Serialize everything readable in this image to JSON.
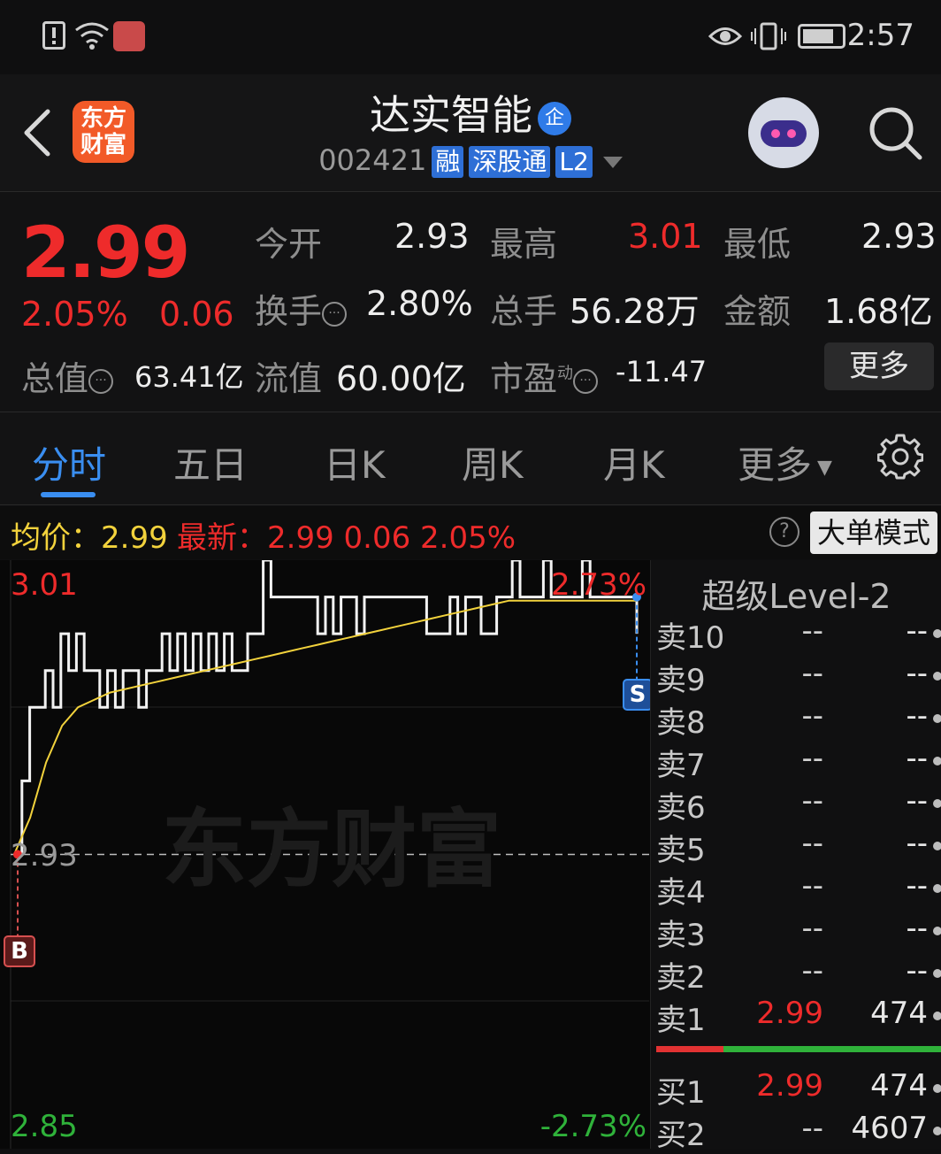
{
  "status_bar": {
    "time": "2:57"
  },
  "header": {
    "title": "达实智能",
    "title_badge": "企",
    "code": "002421",
    "tags": [
      "融",
      "深股通",
      "L2"
    ],
    "logo_line1": "东方",
    "logo_line2": "财富"
  },
  "quote": {
    "price": "2.99",
    "change_pct": "2.05%",
    "change": "0.06",
    "open_label": "今开",
    "open": "2.93",
    "high_label": "最高",
    "high": "3.01",
    "low_label": "最低",
    "low": "2.93",
    "turnover_label": "换手",
    "turnover": "2.80%",
    "volume_label": "总手",
    "volume": "56.28万",
    "amount_label": "金额",
    "amount": "1.68亿",
    "mktcap_label": "总值",
    "mktcap": "63.41亿",
    "float_label": "流值",
    "float": "60.00亿",
    "pe_label": "市盈",
    "pe_sup": "动",
    "pe": "-11.47",
    "more_label": "更多"
  },
  "tabs": [
    {
      "label": "分时"
    },
    {
      "label": "五日"
    },
    {
      "label": "日K"
    },
    {
      "label": "周K"
    },
    {
      "label": "月K"
    },
    {
      "label": "更多"
    }
  ],
  "info": {
    "avg_text": "均价：2.99",
    "latest_text": "最新：2.99  0.06  2.05%",
    "help_icon": "?",
    "big_order_mode": "大单模式"
  },
  "chart_data": {
    "type": "line",
    "y_max_label": "3.01",
    "y_mid_label": "2.93",
    "y_min_label": "2.85",
    "pct_max_label": "2.73%",
    "pct_min_label": "-2.73%",
    "ylim": [
      2.85,
      3.01
    ],
    "prev_close": 2.93,
    "watermark": "东方财富",
    "buy_marker": "B",
    "sell_marker": "S",
    "series": [
      {
        "values": [
          2.93,
          2.95,
          2.97,
          2.97,
          2.98,
          2.97,
          2.99,
          2.98,
          2.99,
          2.98,
          2.98,
          2.97,
          2.98,
          2.97,
          2.98,
          2.98,
          2.97,
          2.98,
          2.98,
          2.99,
          2.98,
          2.99,
          2.98,
          2.99,
          2.98,
          2.99,
          2.98,
          2.99,
          2.98,
          2.98,
          2.99,
          2.99,
          3.01,
          3.0,
          3.0,
          3.0,
          3.0,
          3.0,
          3.0,
          2.99,
          3.0,
          2.99,
          3.0,
          3.0,
          2.99,
          3.0,
          3.0,
          3.0,
          3.0,
          3.0,
          3.0,
          3.0,
          3.0,
          2.99,
          2.99,
          2.99,
          3.0,
          2.99,
          3.0,
          3.0,
          2.99,
          2.99,
          3.0,
          3.0,
          3.01,
          3.0,
          3.0,
          3.0,
          3.01,
          3.0,
          3.0,
          3.0,
          3.0,
          3.01,
          3.0,
          3.0,
          3.0,
          3.0,
          3.0,
          3.0,
          2.99
        ]
      },
      {
        "values": [
          2.93,
          2.94,
          2.955,
          2.965,
          2.97,
          2.972,
          2.974,
          2.975,
          2.976,
          2.977,
          2.978,
          2.979,
          2.98,
          2.981,
          2.982,
          2.983,
          2.984,
          2.985,
          2.986,
          2.987,
          2.988,
          2.989,
          2.99,
          2.991,
          2.992,
          2.993,
          2.994,
          2.995,
          2.996,
          2.997,
          2.998,
          2.999,
          2.999,
          2.999,
          2.999,
          2.999,
          2.999,
          2.999,
          2.999,
          2.999
        ]
      }
    ]
  },
  "order_book": {
    "title": "超级Level-2",
    "asks": [
      {
        "label": "卖10",
        "price": "--",
        "qty": "--"
      },
      {
        "label": "卖9",
        "price": "--",
        "qty": "--"
      },
      {
        "label": "卖8",
        "price": "--",
        "qty": "--"
      },
      {
        "label": "卖7",
        "price": "--",
        "qty": "--"
      },
      {
        "label": "卖6",
        "price": "--",
        "qty": "--"
      },
      {
        "label": "卖5",
        "price": "--",
        "qty": "--"
      },
      {
        "label": "卖4",
        "price": "--",
        "qty": "--"
      },
      {
        "label": "卖3",
        "price": "--",
        "qty": "--"
      },
      {
        "label": "卖2",
        "price": "--",
        "qty": "--"
      },
      {
        "label": "卖1",
        "price": "2.99",
        "qty": "474"
      }
    ],
    "bids": [
      {
        "label": "买1",
        "price": "2.99",
        "qty": "474"
      },
      {
        "label": "买2",
        "price": "--",
        "qty": "4607"
      }
    ]
  },
  "colors": {
    "up": "#ee2b2b",
    "down": "#2fb23a",
    "accent": "#3a8ef0",
    "avg_line": "#f2d23c"
  }
}
